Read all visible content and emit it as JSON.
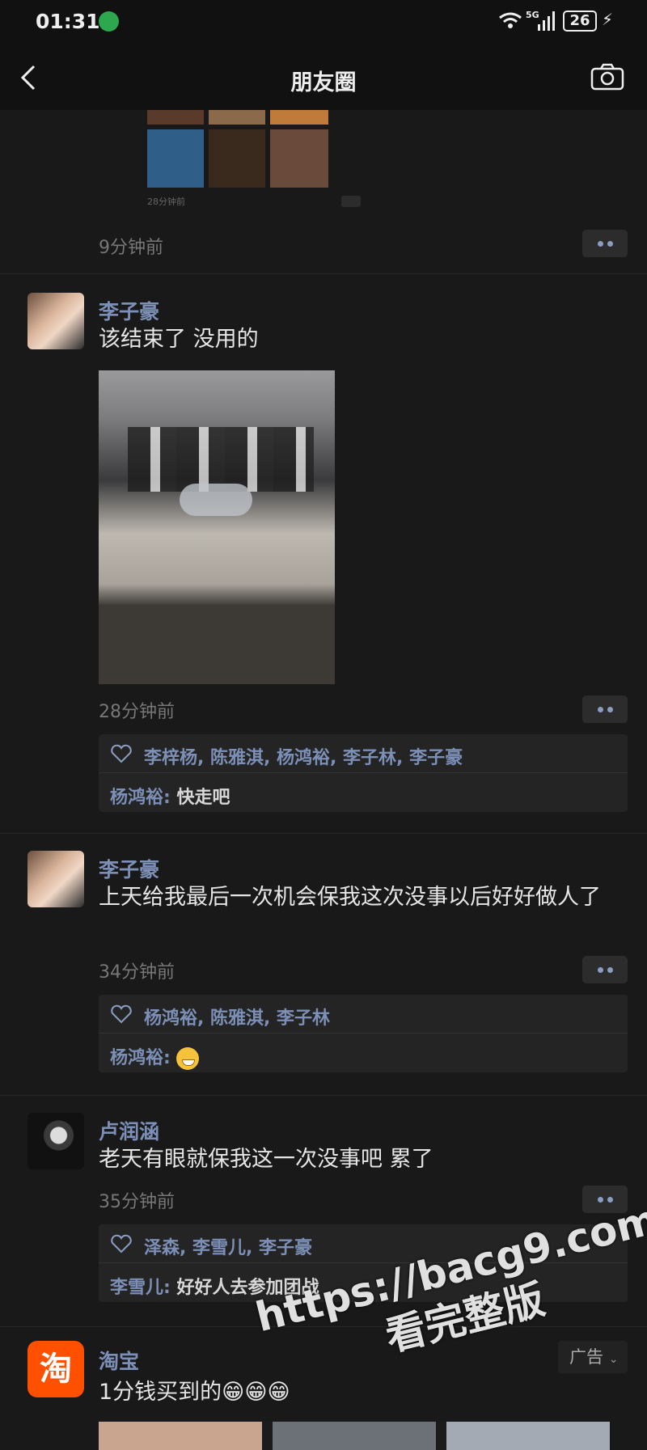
{
  "status_bar": {
    "time": "01:31",
    "network": "5G",
    "battery": "26"
  },
  "nav": {
    "title": "朋友圈"
  },
  "top_post": {
    "time_ago": "9分钟前",
    "thumb_caption": "28分钟前"
  },
  "posts": [
    {
      "name": "李子豪",
      "text": "该结束了 没用的",
      "time_ago": "28分钟前",
      "likers": "李梓杨, 陈雅淇, 杨鸿裕, 李子林, 李子豪",
      "comment_author": "杨鸿裕:",
      "comment_text": "快走吧"
    },
    {
      "name": "李子豪",
      "text": "上天给我最后一次机会保我这次没事以后好好做人了",
      "time_ago": "34分钟前",
      "likers": "杨鸿裕, 陈雅淇, 李子林",
      "comment_author": "杨鸿裕:",
      "comment_emoji": "grinning-face-emoji"
    },
    {
      "name": "卢润涵",
      "text": "老天有眼就保我这一次没事吧 累了",
      "time_ago": "35分钟前",
      "likers": "泽森, 李雪儿, 李子豪",
      "comment_author": "李雪儿:",
      "comment_text": "好好人去参加团战"
    }
  ],
  "ad": {
    "name": "淘宝",
    "logo_char": "淘",
    "tag": "广告",
    "text": "1分钱买到的😁😁😁"
  },
  "watermark": {
    "line1": "https://bacg9.com",
    "line2": "看完整版"
  },
  "colors": {
    "name_link": "#7c8fb6",
    "background": "#191919",
    "taobao": "#ff5000"
  }
}
